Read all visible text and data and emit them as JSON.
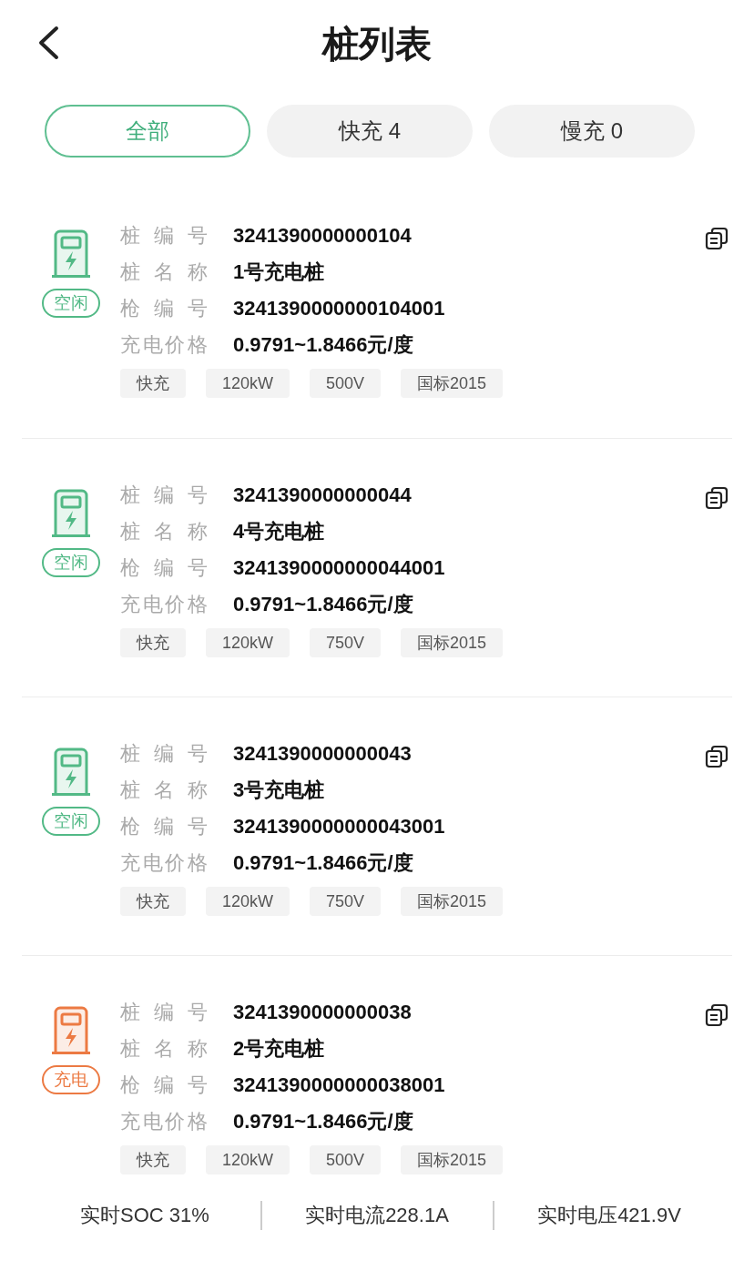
{
  "header": {
    "title": "桩列表"
  },
  "tabs": [
    {
      "label": "全部",
      "selected": true
    },
    {
      "label": "快充 4",
      "selected": false
    },
    {
      "label": "慢充 0",
      "selected": false
    }
  ],
  "piles": [
    {
      "status": {
        "kind": "idle",
        "label": "空闲"
      },
      "fields": [
        {
          "label": "桩编号",
          "value": "3241390000000104"
        },
        {
          "label": "桩名称",
          "value": "1号充电桩"
        },
        {
          "label": "枪编号",
          "value": "3241390000000104001"
        },
        {
          "label": "充电价格",
          "value": "0.9791~1.8466元/度"
        }
      ],
      "tags": [
        "快充",
        "120kW",
        "500V",
        "国标2015"
      ]
    },
    {
      "status": {
        "kind": "idle",
        "label": "空闲"
      },
      "fields": [
        {
          "label": "桩编号",
          "value": "3241390000000044"
        },
        {
          "label": "桩名称",
          "value": "4号充电桩"
        },
        {
          "label": "枪编号",
          "value": "3241390000000044001"
        },
        {
          "label": "充电价格",
          "value": "0.9791~1.8466元/度"
        }
      ],
      "tags": [
        "快充",
        "120kW",
        "750V",
        "国标2015"
      ]
    },
    {
      "status": {
        "kind": "idle",
        "label": "空闲"
      },
      "fields": [
        {
          "label": "桩编号",
          "value": "3241390000000043"
        },
        {
          "label": "桩名称",
          "value": "3号充电桩"
        },
        {
          "label": "枪编号",
          "value": "3241390000000043001"
        },
        {
          "label": "充电价格",
          "value": "0.9791~1.8466元/度"
        }
      ],
      "tags": [
        "快充",
        "120kW",
        "750V",
        "国标2015"
      ]
    },
    {
      "status": {
        "kind": "charging",
        "label": "充电"
      },
      "fields": [
        {
          "label": "桩编号",
          "value": "3241390000000038"
        },
        {
          "label": "桩名称",
          "value": "2号充电桩"
        },
        {
          "label": "枪编号",
          "value": "3241390000000038001"
        },
        {
          "label": "充电价格",
          "value": "0.9791~1.8466元/度"
        }
      ],
      "tags": [
        "快充",
        "120kW",
        "500V",
        "国标2015"
      ],
      "realtime": [
        "实时SOC 31%",
        "实时电流228.1A",
        "实时电压421.9V"
      ]
    }
  ]
}
